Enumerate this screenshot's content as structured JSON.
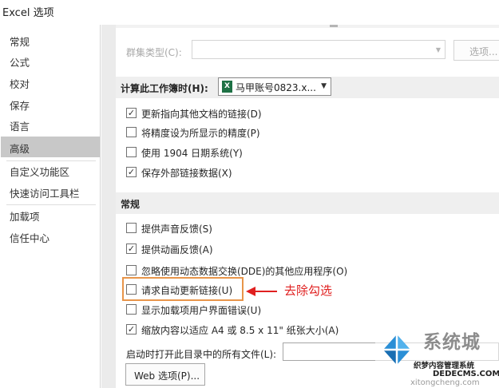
{
  "window": {
    "title": "Excel 选项"
  },
  "sidebar": {
    "items": [
      {
        "label": "常规"
      },
      {
        "label": "公式"
      },
      {
        "label": "校对"
      },
      {
        "label": "保存"
      },
      {
        "label": "语言"
      },
      {
        "label": "高级",
        "selected": true
      },
      {
        "label": "自定义功能区"
      },
      {
        "label": "快速访问工具栏"
      },
      {
        "label": "加载项"
      },
      {
        "label": "信任中心"
      }
    ]
  },
  "cluster": {
    "label": "群集类型(C):",
    "value": "",
    "button_label": "选项..."
  },
  "workbook_section": {
    "label": "计算此工作簿时(H):",
    "selected_workbook": "马甲账号0823.x...",
    "icon": "excel-file-icon",
    "options": [
      {
        "label": "更新指向其他文档的链接(D)",
        "checked": true
      },
      {
        "label": "将精度设为所显示的精度(P)",
        "checked": false
      },
      {
        "label": "使用 1904 日期系统(Y)",
        "checked": false
      },
      {
        "label": "保存外部链接数据(X)",
        "checked": true
      }
    ]
  },
  "general_section": {
    "title": "常规",
    "options": [
      {
        "label": "提供声音反馈(S)",
        "checked": false
      },
      {
        "label": "提供动画反馈(A)",
        "checked": true
      },
      {
        "label": "忽略使用动态数据交换(DDE)的其他应用程序(O)",
        "checked": false
      },
      {
        "label": "请求自动更新链接(U)",
        "checked": false
      },
      {
        "label": "显示加载项用户界面错误(U)",
        "checked": false
      },
      {
        "label": "缩放内容以适应 A4 或 8.5 x 11\" 纸张大小(A)",
        "checked": true
      }
    ],
    "startup_label": "启动时打开此目录中的所有文件(L):",
    "startup_value": "",
    "web_options_label": "Web 选项(P)..."
  },
  "annotation": {
    "text": "去除勾选",
    "color": "#e02020",
    "highlight_color": "#e8954a"
  },
  "watermark": {
    "big_text": "系统城",
    "mid_text": "织梦内容管理系统",
    "domain": "DEDECMS.COM",
    "url": "xitongcheng.com"
  }
}
